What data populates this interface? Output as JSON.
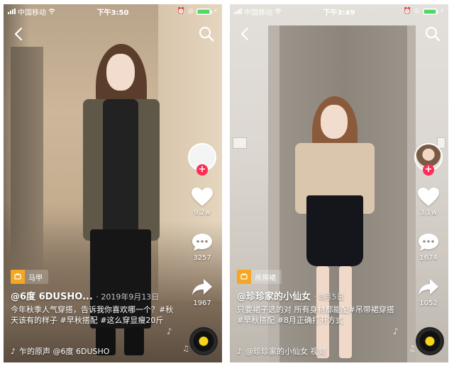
{
  "colors": {
    "accent": "#fe2c55",
    "tag": "#f5a623",
    "battery": "#4cd964",
    "disc_center": "#f7d51d"
  },
  "screens": [
    {
      "status": {
        "carrier": "中国移动",
        "time": "下午3:50"
      },
      "icons": {
        "back": "back-chevron-icon",
        "search": "search-icon",
        "like": "heart-icon",
        "comment": "comment-icon",
        "share": "share-icon"
      },
      "likes": "9.2w",
      "comments": "3257",
      "shares": "1967",
      "product_tag": "马甲",
      "author": "@6度 6DUSHO...",
      "date": "· 2019年9月13日",
      "caption": "今年秋季人气穿搭，告诉我你喜欢哪一个？#秋天该有的样子 #早秋搭配 #这么穿显瘦20斤",
      "music": "乍的原声    @6度 6DUSHO"
    },
    {
      "status": {
        "carrier": "中国移动",
        "time": "下午3:49"
      },
      "icons": {
        "back": "back-chevron-icon",
        "search": "search-icon",
        "like": "heart-icon",
        "comment": "comment-icon",
        "share": "share-icon"
      },
      "likes": "3.1w",
      "comments": "1674",
      "shares": "1052",
      "product_tag": "吊带裙",
      "author": "@珍珍家的小仙女",
      "date": "· 8月5日",
      "caption": "只要裙子选的对 所有身材都能配#吊带裙穿搭 #早秋搭配 #8月正确打开方式",
      "music": "@珍珍家的小仙女    视频"
    }
  ]
}
